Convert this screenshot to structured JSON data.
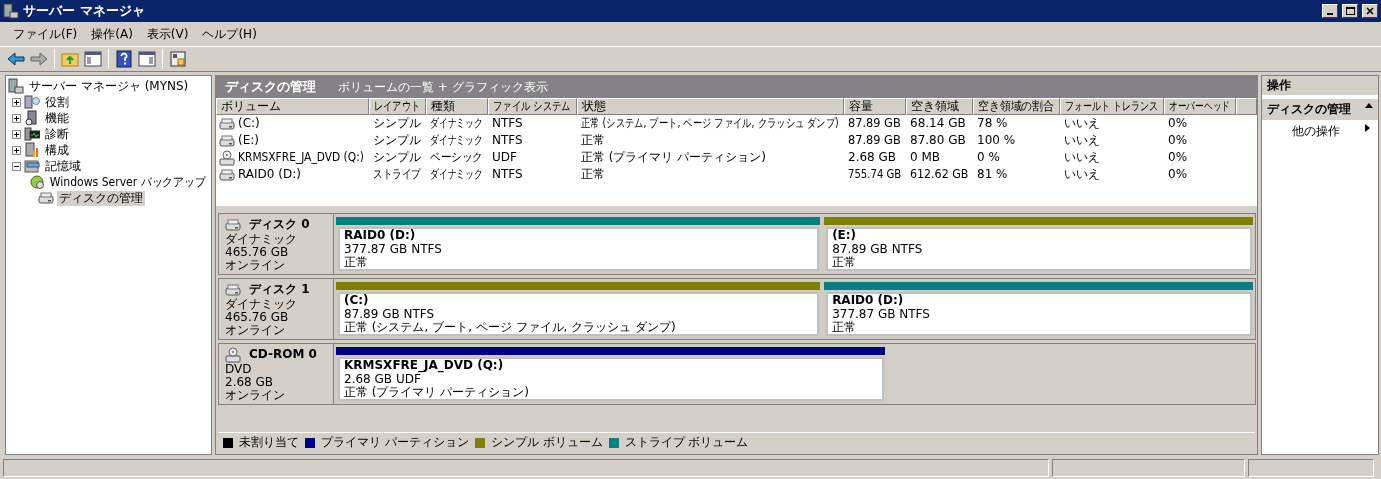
{
  "window": {
    "title": "サーバー マネージャ"
  },
  "menu": [
    "ファイル(F)",
    "操作(A)",
    "表示(V)",
    "ヘルプ(H)"
  ],
  "tree": {
    "label": "サーバー マネージャ (MYNS)",
    "children": [
      {
        "label": "役割",
        "expanded": false,
        "selected": false,
        "kind": "roles"
      },
      {
        "label": "機能",
        "expanded": false,
        "selected": false,
        "kind": "features"
      },
      {
        "label": "診断",
        "expanded": false,
        "selected": false,
        "kind": "diagnostics"
      },
      {
        "label": "構成",
        "expanded": false,
        "selected": false,
        "kind": "config"
      },
      {
        "label": "記憶域",
        "expanded": true,
        "selected": false,
        "kind": "storage",
        "children": [
          {
            "label": "Windows Server バックアップ",
            "selected": false,
            "kind": "backup"
          },
          {
            "label": "ディスクの管理",
            "selected": true,
            "kind": "disk"
          }
        ]
      }
    ]
  },
  "center_header": {
    "title": "ディスクの管理",
    "view": "ボリュームの一覧 + グラフィック表示"
  },
  "table": {
    "columns": [
      "ボリューム",
      "レイアウト",
      "種類",
      "ファイル システム",
      "状態",
      "容量",
      "空き領域",
      "空き領域の割合",
      "フォールト トレランス",
      "オーバーヘッド"
    ],
    "rows": [
      {
        "kind": "disk",
        "cells": [
          "(C:)",
          "シンプル",
          "ダイナミック",
          "NTFS",
          "正常 (システム, ブート, ページ ファイル, クラッシュ ダンプ)",
          "87.89 GB",
          "68.14 GB",
          "78 %",
          "いいえ",
          "0%"
        ]
      },
      {
        "kind": "disk",
        "cells": [
          "(E:)",
          "シンプル",
          "ダイナミック",
          "NTFS",
          "正常",
          "87.89 GB",
          "87.80 GB",
          "100 %",
          "いいえ",
          "0%"
        ]
      },
      {
        "kind": "cdrom",
        "cells": [
          "KRMSXFRE_JA_DVD (Q:)",
          "シンプル",
          "ベーシック",
          "UDF",
          "正常 (プライマリ パーティション)",
          "2.68 GB",
          "0 MB",
          "0 %",
          "いいえ",
          "0%"
        ]
      },
      {
        "kind": "disk",
        "cells": [
          "RAID0 (D:)",
          "ストライプ",
          "ダイナミック",
          "NTFS",
          "正常",
          "755.74 GB",
          "612.62 GB",
          "81 %",
          "いいえ",
          "0%"
        ]
      }
    ]
  },
  "disks": [
    {
      "kind": "disk",
      "name": "ディスク 0",
      "type": "ダイナミック",
      "size": "465.76 GB",
      "status": "オンライン",
      "partitions": [
        {
          "name": "RAID0  (D:)",
          "detail": "377.87 GB NTFS",
          "status": "正常",
          "color": "#008080"
        },
        {
          "name": "(E:)",
          "detail": "87.89 GB NTFS",
          "status": "正常",
          "color": "#808000"
        }
      ]
    },
    {
      "kind": "disk",
      "name": "ディスク 1",
      "type": "ダイナミック",
      "size": "465.76 GB",
      "status": "オンライン",
      "partitions": [
        {
          "name": "(C:)",
          "detail": "87.89 GB NTFS",
          "status": "正常 (システム, ブート, ページ ファイル, クラッシュ ダンプ)",
          "color": "#808000"
        },
        {
          "name": "RAID0  (D:)",
          "detail": "377.87 GB NTFS",
          "status": "正常",
          "color": "#008080"
        }
      ]
    },
    {
      "kind": "cdrom",
      "name": "CD-ROM 0",
      "type": "DVD",
      "size": "2.68 GB",
      "status": "オンライン",
      "partitions": [
        {
          "name": "KRMSXFRE_JA_DVD  (Q:)",
          "detail": "2.68 GB UDF",
          "status": "正常 (プライマリ パーティション)",
          "color": "#000080"
        }
      ]
    }
  ],
  "legend": [
    {
      "label": "未割り当て",
      "color": "#000000"
    },
    {
      "label": "プライマリ パーティション",
      "color": "#000080"
    },
    {
      "label": "シンプル ボリューム",
      "color": "#808000"
    },
    {
      "label": "ストライプ ボリューム",
      "color": "#008080"
    }
  ],
  "actions": {
    "title": "操作",
    "section": "ディスクの管理",
    "expanded": true,
    "items": [
      "他の操作"
    ]
  }
}
